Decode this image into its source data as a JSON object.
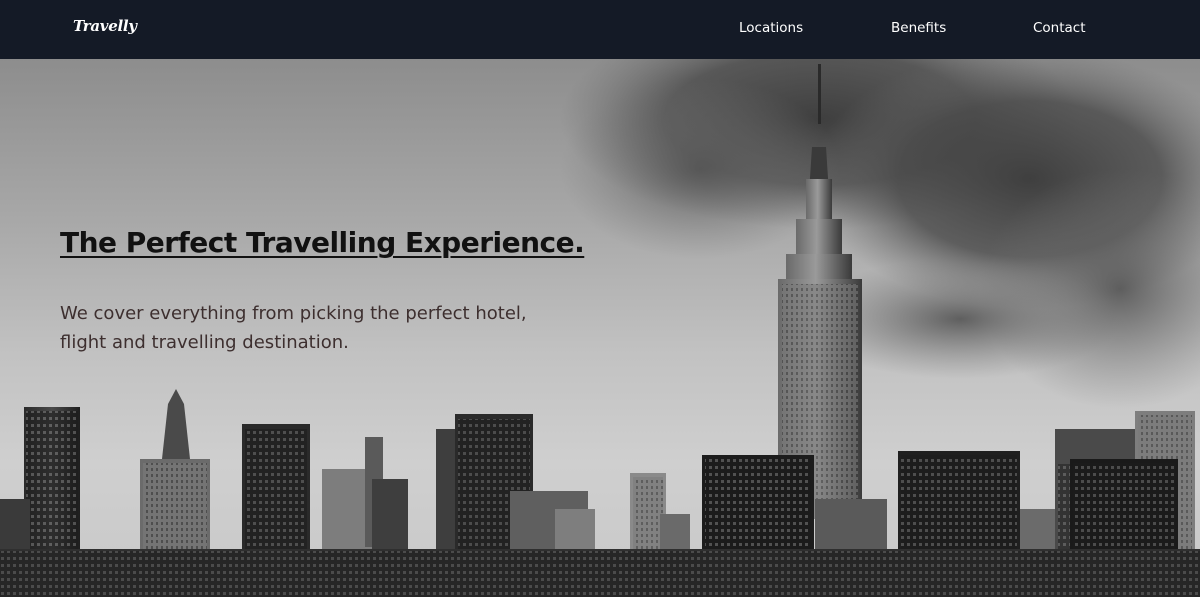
{
  "brand": {
    "logo": "Travelly"
  },
  "nav": {
    "links": [
      {
        "label": "Locations"
      },
      {
        "label": "Benefits"
      },
      {
        "label": "Contact"
      }
    ]
  },
  "hero": {
    "title": "The Perfect Travelling Experience.",
    "subtitle": "We cover everything from picking the perfect hotel, flight and travelling destination.",
    "background_image": "black-and-white-new-york-city-skyline-photo"
  },
  "colors": {
    "navbar_bg": "#141a26",
    "nav_text": "#ffffff",
    "title_text": "#111111",
    "subtitle_text": "#3d2f2f"
  }
}
